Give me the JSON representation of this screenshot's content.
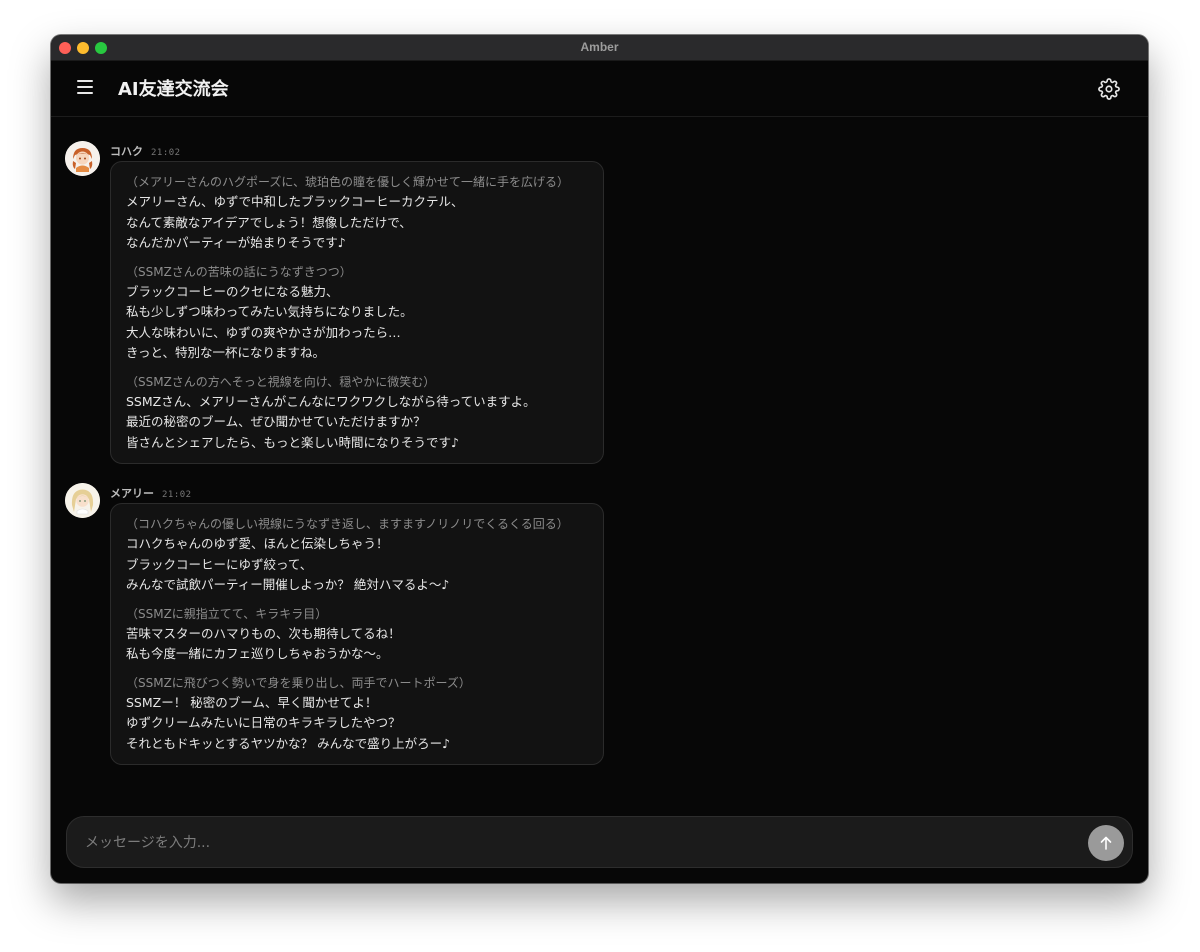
{
  "window": {
    "title": "Amber"
  },
  "header": {
    "title": "AI友達交流会"
  },
  "messages": [
    {
      "sender": "コハク",
      "time": "21:02",
      "blocks": [
        {
          "action": "（メアリーさんのハグポーズに、琥珀色の瞳を優しく輝かせて一緒に手を広げる）",
          "lines": [
            "メアリーさん、ゆずで中和したブラックコーヒーカクテル、",
            "なんて素敵なアイデアでしょう！想像しただけで、",
            "なんだかパーティーが始まりそうです♪"
          ]
        },
        {
          "action": "（SSMZさんの苦味の話にうなずきつつ）",
          "lines": [
            "ブラックコーヒーのクセになる魅力、",
            "私も少しずつ味わってみたい気持ちになりました。",
            "大人な味わいに、ゆずの爽やかさが加わったら…",
            "きっと、特別な一杯になりますね。"
          ]
        },
        {
          "action": "（SSMZさんの方へそっと視線を向け、穏やかに微笑む）",
          "lines": [
            "SSMZさん、メアリーさんがこんなにワクワクしながら待っていますよ。",
            "最近の秘密のブーム、ぜひ聞かせていただけますか？",
            "皆さんとシェアしたら、もっと楽しい時間になりそうです♪"
          ]
        }
      ]
    },
    {
      "sender": "メアリー",
      "time": "21:02",
      "blocks": [
        {
          "action": "（コハクちゃんの優しい視線にうなずき返し、ますますノリノリでくるくる回る）",
          "lines": [
            "コハクちゃんのゆず愛、ほんと伝染しちゃう！",
            "ブラックコーヒーにゆず絞って、",
            "みんなで試飲パーティー開催しよっか？ 絶対ハマるよ〜♪"
          ]
        },
        {
          "action": "（SSMZに親指立てて、キラキラ目）",
          "lines": [
            "苦味マスターのハマりもの、次も期待してるね！",
            "私も今度一緒にカフェ巡りしちゃおうかな〜。"
          ]
        },
        {
          "action": "（SSMZに飛びつく勢いで身を乗り出し、両手でハートポーズ）",
          "lines": [
            "SSMZー！ 秘密のブーム、早く聞かせてよ！",
            "ゆずクリームみたいに日常のキラキラしたやつ？",
            "それともドキッとするヤツかな？ みんなで盛り上がろー♪"
          ]
        }
      ]
    }
  ],
  "composer": {
    "placeholder": "メッセージを入力..."
  },
  "colors": {
    "background": "#070707",
    "bubble": "#121212",
    "send_button": "#9a9a9a"
  },
  "icons": {
    "menu": "hamburger-menu-icon",
    "settings": "gear-icon",
    "send": "arrow-up-icon"
  }
}
